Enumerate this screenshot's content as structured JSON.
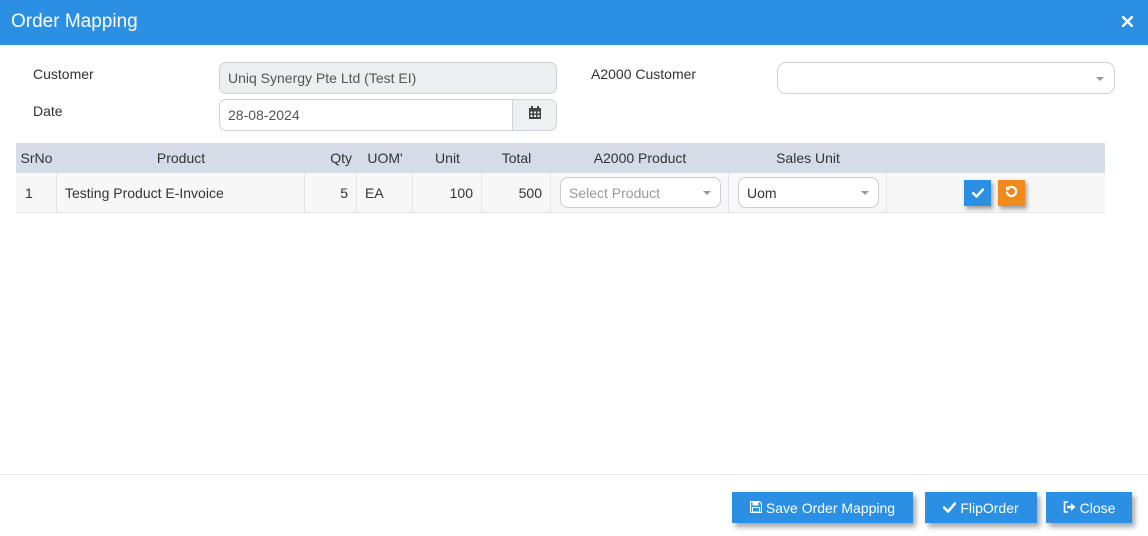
{
  "dialog": {
    "title": "Order Mapping"
  },
  "form": {
    "customer_label": "Customer",
    "customer_value": "Uniq Synergy Pte Ltd (Test EI)",
    "date_label": "Date",
    "date_value": "28-08-2024",
    "a2000_customer_label": "A2000 Customer",
    "a2000_customer_value": ""
  },
  "grid": {
    "headers": [
      "SrNo",
      "Product",
      "Qty",
      "UOM'",
      "Unit",
      "Total",
      "A2000 Product",
      "Sales Unit",
      ""
    ],
    "rows": [
      {
        "srno": "1",
        "product": "Testing Product E-Invoice",
        "qty": "5",
        "uom": "EA",
        "unit": "100",
        "total": "500",
        "a2000_product_placeholder": "Select Product",
        "sales_unit": "Uom"
      }
    ]
  },
  "footer": {
    "save_label": "Save Order Mapping",
    "flip_label": "FlipOrder",
    "close_label": "Close"
  },
  "colors": {
    "primary": "#2b8fe3",
    "warning": "#f08a1c",
    "header_bg": "#d4dde7"
  },
  "icons": [
    "close-icon",
    "calendar-icon",
    "chevron-down-icon",
    "check-icon",
    "undo-icon",
    "save-icon",
    "sign-out-icon"
  ]
}
